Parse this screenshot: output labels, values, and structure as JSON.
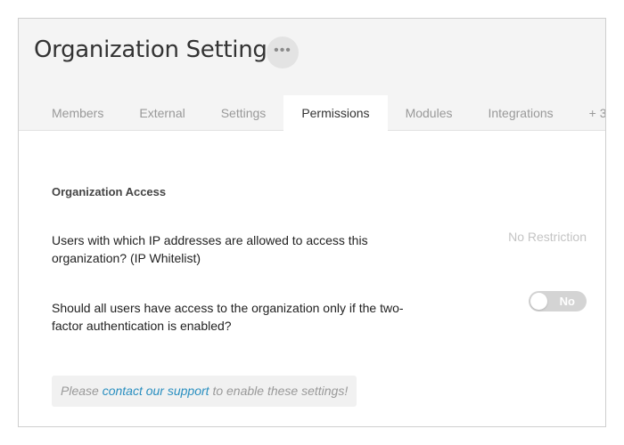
{
  "header": {
    "title": "Organization Settings",
    "more_icon": "•••"
  },
  "tabs": [
    {
      "label": "Members",
      "active": false
    },
    {
      "label": "External",
      "active": false
    },
    {
      "label": "Settings",
      "active": false
    },
    {
      "label": "Permissions",
      "active": true
    },
    {
      "label": "Modules",
      "active": false
    },
    {
      "label": "Integrations",
      "active": false
    },
    {
      "label": "+ 3",
      "active": false
    }
  ],
  "section": {
    "title": "Organization Access"
  },
  "settings": {
    "ip_whitelist": {
      "label": "Users with which IP addresses are allowed to access this organization? (IP Whitelist)",
      "value": "No Restriction"
    },
    "two_factor": {
      "label": "Should all users have access to the organization only if the two-factor authentication is enabled?",
      "toggle_label": "No",
      "enabled": false
    }
  },
  "notice": {
    "prefix": "Please ",
    "link_text": "contact our support",
    "suffix": " to enable these settings!"
  },
  "colors": {
    "link": "#2a8fc0",
    "header_bg": "#f4f4f4",
    "toggle_off": "#d4d4d4"
  }
}
